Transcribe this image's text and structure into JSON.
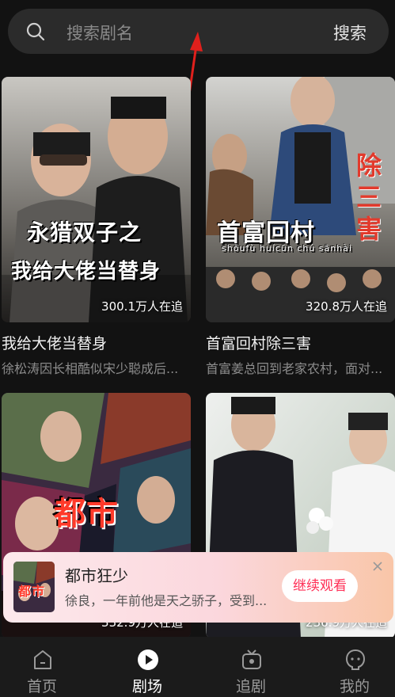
{
  "search": {
    "placeholder": "搜索剧名",
    "button_label": "搜索"
  },
  "dramas": [
    {
      "poster_title_line1": "永猎双子之",
      "poster_title_line2": "我给大佬当替身",
      "watching": "300.1万人在追",
      "title": "我给大佬当替身",
      "desc": "徐松涛因长相酷似宋少聪成后..."
    },
    {
      "poster_title": "首富回村",
      "poster_pinyin": "shǒufù huícūn chú sānhài",
      "poster_side_text": "除三害",
      "watching": "320.8万人在追",
      "title": "首富回村除三害",
      "desc": "首富姜总回到老家农村，面对..."
    },
    {
      "poster_title": "都市",
      "watching": "332.9万人在追"
    },
    {
      "watching": "236.9万人在追"
    }
  ],
  "continue_watching": {
    "thumb_text": "都市",
    "title": "都市狂少",
    "desc": "徐良，一年前他是天之骄子，受到...",
    "button_label": "继续观看"
  },
  "tabbar": [
    {
      "label": "首页",
      "icon": "home-icon",
      "active": false
    },
    {
      "label": "剧场",
      "icon": "theater-icon",
      "active": true
    },
    {
      "label": "追剧",
      "icon": "tv-icon",
      "active": false
    },
    {
      "label": "我的",
      "icon": "profile-icon",
      "active": false
    }
  ],
  "colors": {
    "background": "#121212",
    "accent": "#ff2f56",
    "annotation_arrow": "#e0201c"
  }
}
